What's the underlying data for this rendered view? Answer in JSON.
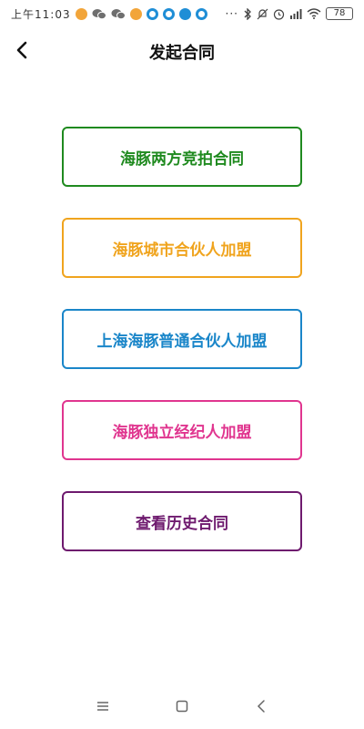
{
  "status_bar": {
    "time": "上午11:03",
    "more": "···",
    "battery": "78",
    "app_icons": [
      "orange-app-icon",
      "wechat-icon",
      "wechat-icon",
      "orange-app-icon",
      "blue-app-icon",
      "blue-app-icon",
      "zhihu-icon",
      "blue-app-icon"
    ]
  },
  "header": {
    "title": "发起合同",
    "back_icon": "chevron-left-icon"
  },
  "options": [
    {
      "label": "海豚两方竞拍合同",
      "color": "#1f8a1f"
    },
    {
      "label": "海豚城市合伙人加盟",
      "color": "#f0a41e"
    },
    {
      "label": "上海海豚普通合伙人加盟",
      "color": "#1a86c9"
    },
    {
      "label": "海豚独立经纪人加盟",
      "color": "#e0358f"
    },
    {
      "label": "查看历史合同",
      "color": "#6e1a6e"
    }
  ],
  "nav": {
    "menu_icon": "menu-icon",
    "home_icon": "home-square-icon",
    "back_icon": "back-triangle-icon"
  }
}
